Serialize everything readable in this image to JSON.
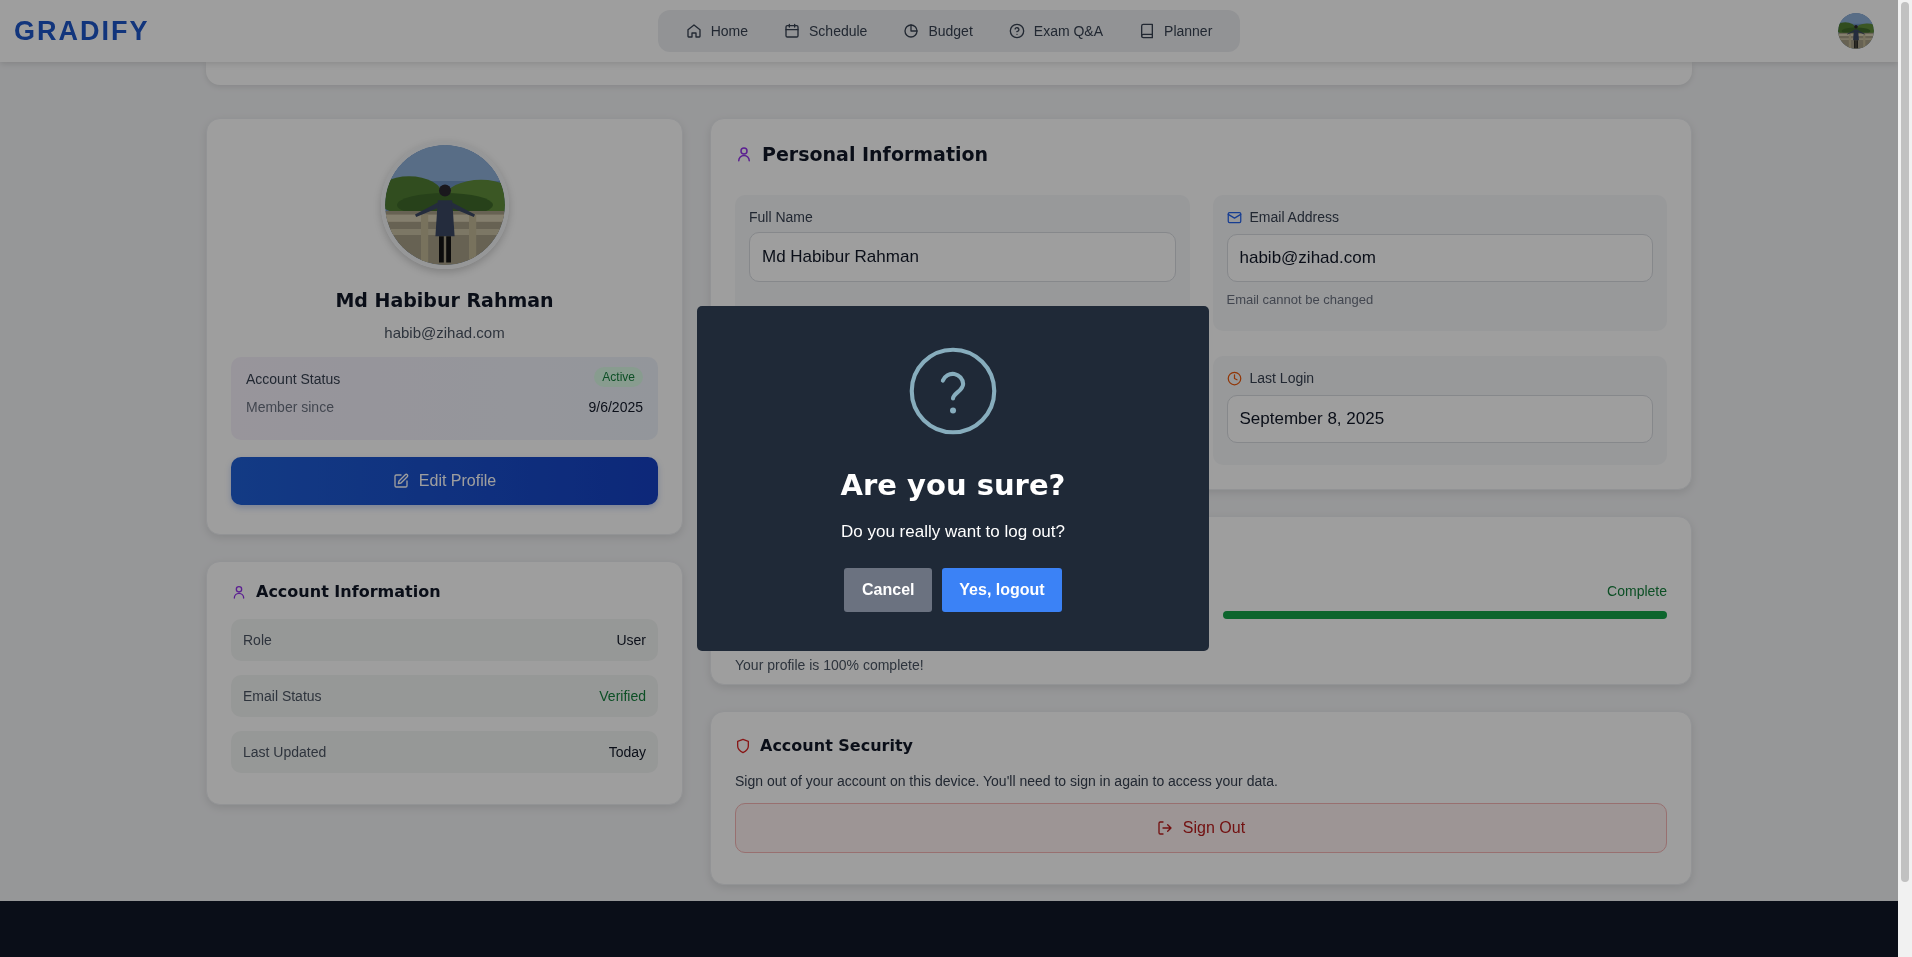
{
  "header": {
    "logo": "GRADIFY",
    "nav": [
      {
        "label": "Home"
      },
      {
        "label": "Schedule"
      },
      {
        "label": "Budget"
      },
      {
        "label": "Exam Q&A"
      },
      {
        "label": "Planner"
      }
    ]
  },
  "profile_card": {
    "name": "Md Habibur Rahman",
    "email": "habib@zihad.com",
    "status_label": "Account Status",
    "status_badge": "Active",
    "member_label": "Member since",
    "member_value": "9/6/2025",
    "edit_button": "Edit Profile"
  },
  "account_information": {
    "title": "Account Information",
    "rows": [
      {
        "label": "Role",
        "value": "User",
        "kind": "plain"
      },
      {
        "label": "Email Status",
        "value": "Verified",
        "kind": "success"
      },
      {
        "label": "Last Updated",
        "value": "Today",
        "kind": "plain"
      }
    ]
  },
  "personal_information": {
    "title": "Personal Information",
    "fields": [
      {
        "label": "Full Name",
        "value": "Md Habibur Rahman"
      },
      {
        "label": "Email Address",
        "value": "habib@zihad.com",
        "note": "Email cannot be changed"
      },
      {
        "label": "Last Login",
        "value": "September 8, 2025"
      }
    ]
  },
  "profile_completion": {
    "status": "Complete",
    "level": 1,
    "note": "Your profile is 100% complete!"
  },
  "account_security": {
    "title": "Account Security",
    "text": "Sign out of your account on this device. You'll need to sign in again to access your data.",
    "button": "Sign Out"
  },
  "dialog": {
    "title": "Are you sure?",
    "message": "Do you really want to log out?",
    "buttons": [
      {
        "label": "Cancel",
        "kind": "secondary"
      },
      {
        "label": "Yes, logout",
        "kind": "primary"
      }
    ]
  }
}
